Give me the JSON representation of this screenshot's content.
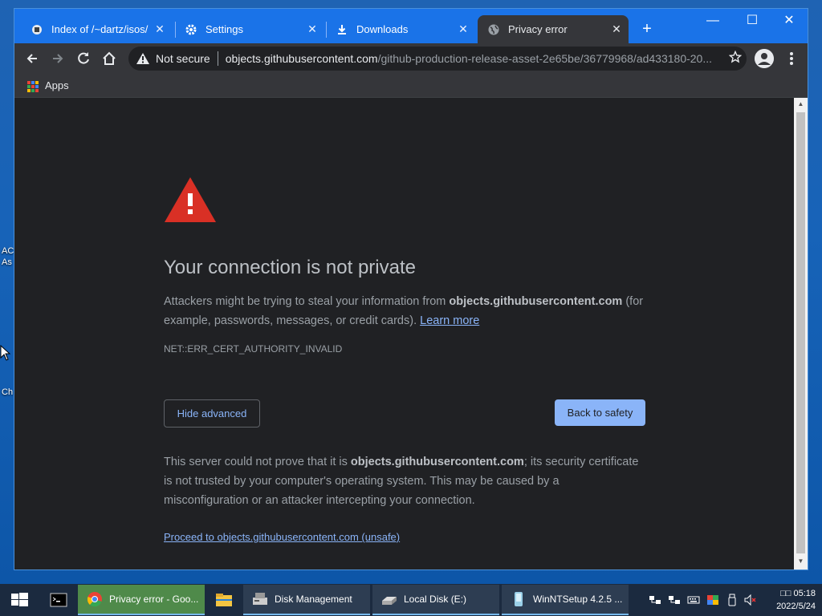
{
  "desktop": {
    "fragments": [
      "AC",
      "As",
      "Ch"
    ]
  },
  "browser": {
    "tabs": [
      {
        "title": "Index of /~dartz/isos/",
        "icon": "page-icon",
        "active": false
      },
      {
        "title": "Settings",
        "icon": "gear-icon",
        "active": false
      },
      {
        "title": "Downloads",
        "icon": "download-icon",
        "active": false
      },
      {
        "title": "Privacy error",
        "icon": "globe-icon",
        "active": true
      }
    ],
    "tab_close_glyph": "✕",
    "new_tab_glyph": "+",
    "window_controls": {
      "minimize": "—",
      "maximize": "☐",
      "close": "✕"
    },
    "omnibox": {
      "security_label": "Not secure",
      "host": "objects.githubusercontent.com",
      "path": "/github-production-release-asset-2e65be/36779968/ad433180-20..."
    },
    "bookmarks": {
      "apps_label": "Apps"
    }
  },
  "interstitial": {
    "heading": "Your connection is not private",
    "explanation_pre": "Attackers might be trying to steal your information from ",
    "explanation_host": "objects.githubusercontent.com",
    "explanation_post": " (for example, passwords, messages, or credit cards). ",
    "learn_more": "Learn more",
    "error_code": "NET::ERR_CERT_AUTHORITY_INVALID",
    "hide_advanced": "Hide advanced",
    "back_to_safety": "Back to safety",
    "details_pre": "This server could not prove that it is ",
    "details_host": "objects.githubusercontent.com",
    "details_post": "; its security certificate is not trusted by your computer's operating system. This may be caused by a misconfiguration or an attacker intercepting your connection.",
    "proceed_link": "Proceed to objects.githubusercontent.com (unsafe)"
  },
  "taskbar": {
    "items": [
      {
        "label": "Privacy error - Goo...",
        "icon": "chrome-icon"
      },
      {
        "label": "",
        "icon": "file-explorer-icon"
      },
      {
        "label": "Disk Management",
        "icon": "disk-management-icon"
      },
      {
        "label": "Local Disk (E:)",
        "icon": "drive-icon"
      },
      {
        "label": "WinNTSetup 4.2.5  ...",
        "icon": "winntsetup-icon"
      }
    ],
    "clock": {
      "time": "□□ 05:18",
      "date": "2022/5/24"
    }
  },
  "colors": {
    "tabstrip": "#1a73e8",
    "page_bg": "#202124",
    "warning_red": "#d93025",
    "link_blue": "#8ab4f8"
  }
}
